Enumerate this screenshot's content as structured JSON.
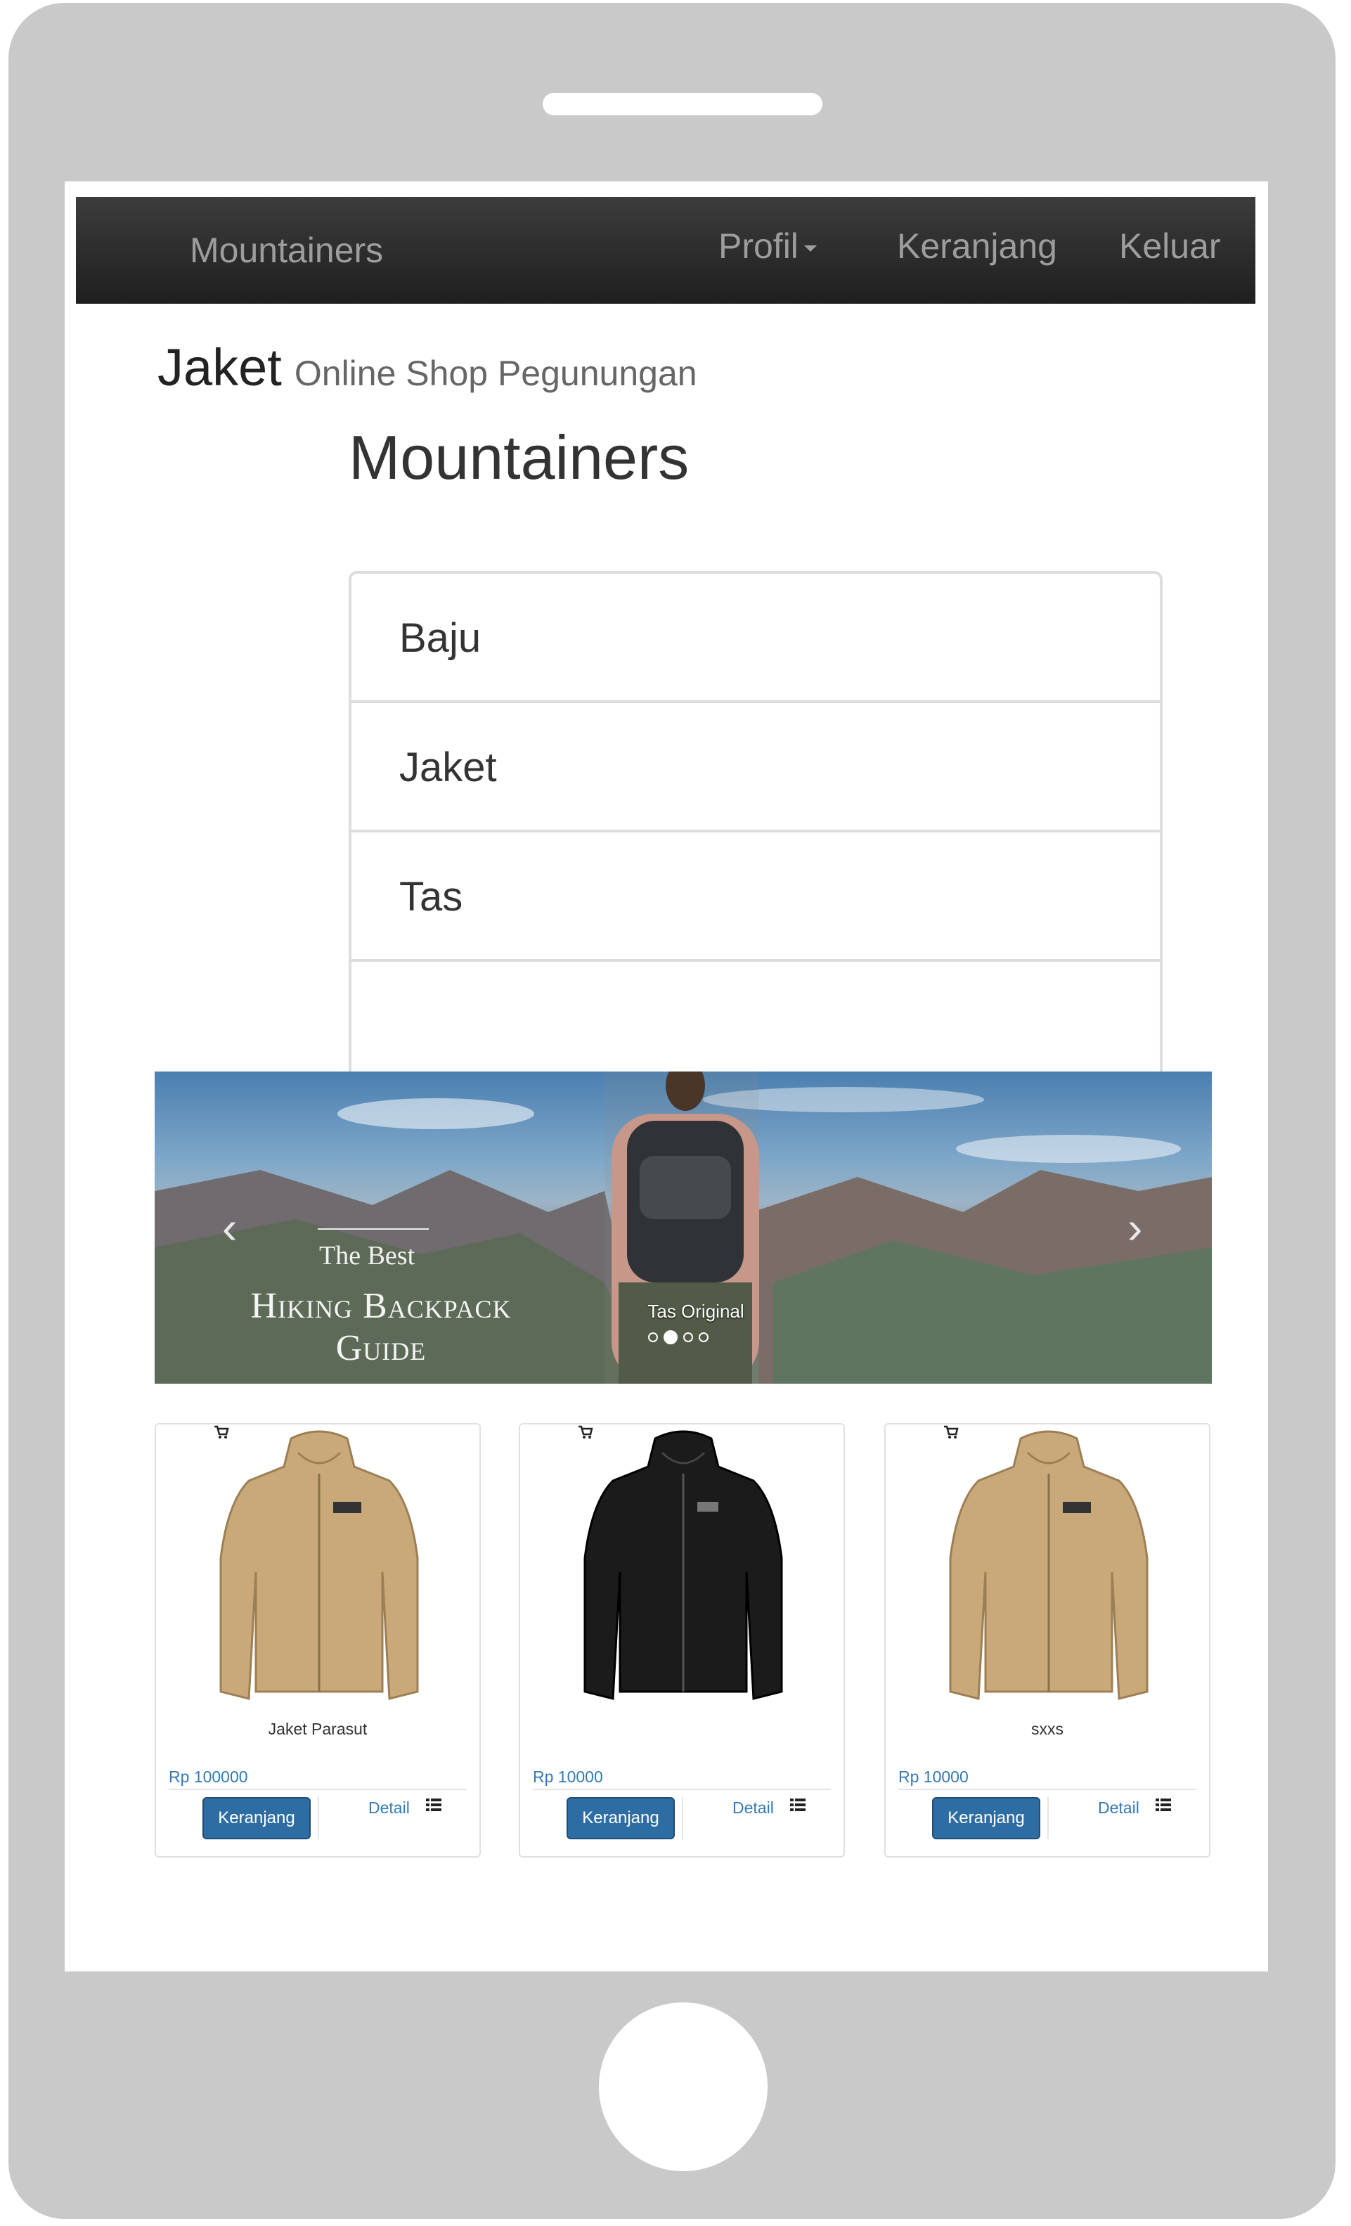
{
  "navbar": {
    "brand": "Mountainers",
    "items": [
      {
        "label": "Profil"
      },
      {
        "label": "Keranjang"
      },
      {
        "label": "Keluar"
      }
    ]
  },
  "page_header": {
    "title": "Jaket",
    "subtitle": "Online Shop Pegunungan"
  },
  "sidebar": {
    "title": "Mountainers",
    "categories": [
      {
        "label": "Baju"
      },
      {
        "label": "Jaket"
      },
      {
        "label": "Tas"
      }
    ]
  },
  "carousel": {
    "promo_small": "The Best",
    "promo_line1": "Hiking Backpack",
    "promo_line2": "Guide",
    "caption": "Tas Original",
    "slide_count": 4,
    "active_index": 1
  },
  "products": [
    {
      "name": "Jaket Parasut",
      "price": "Rp 100000",
      "cart_label": "Keranjang",
      "detail_label": "Detail",
      "jacket_color": "#c9a97a"
    },
    {
      "name": "",
      "price": "Rp 10000",
      "cart_label": "Keranjang",
      "detail_label": "Detail",
      "jacket_color": "#1b1b1b"
    },
    {
      "name": "sxxs",
      "price": "Rp 10000",
      "cart_label": "Keranjang",
      "detail_label": "Detail",
      "jacket_color": "#c9a97a"
    }
  ],
  "colors": {
    "navbar": "#222222",
    "link": "#337ab7",
    "primary_button": "#2e6da4",
    "device_frame": "#c9c9c9"
  }
}
